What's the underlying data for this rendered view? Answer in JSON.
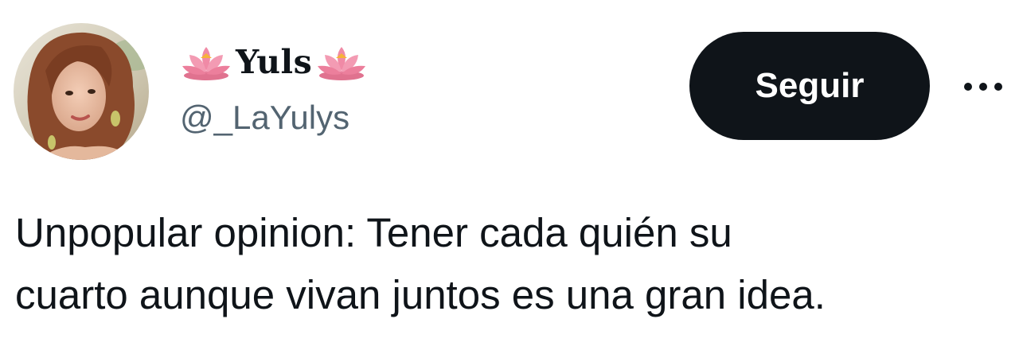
{
  "tweet": {
    "author": {
      "display_name": "Yuls",
      "name_decoration_icon": "lotus-flower-emoji",
      "handle": "@_LaYulys",
      "avatar_icon": "profile-photo"
    },
    "follow_label": "Seguir",
    "more_icon": "more-horizontal-icon",
    "text_line_1": "Unpopular opinion: Tener cada quién su",
    "text_line_2": "cuarto aunque vivan juntos es una gran idea."
  },
  "colors": {
    "text_primary": "#0f1419",
    "text_secondary": "#536471",
    "button_bg": "#0f1419",
    "button_text": "#ffffff",
    "lotus_pink": "#f08aa6",
    "lotus_center": "#f6b23a"
  }
}
